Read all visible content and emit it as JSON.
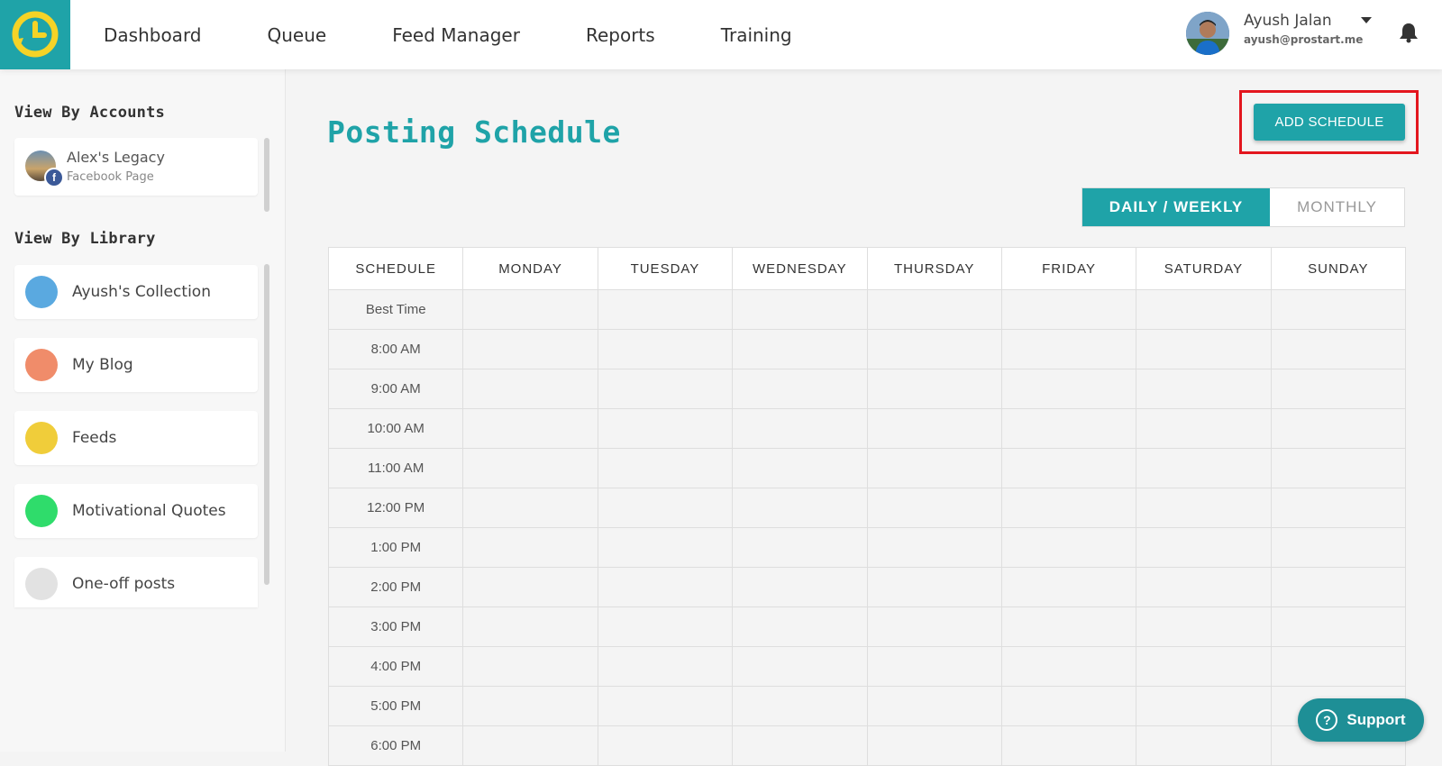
{
  "nav": {
    "items": [
      "Dashboard",
      "Queue",
      "Feed Manager",
      "Reports",
      "Training"
    ]
  },
  "user": {
    "name": "Ayush Jalan",
    "email": "ayush@prostart.me"
  },
  "sidebar": {
    "accounts_heading": "View By Accounts",
    "accounts": [
      {
        "name": "Alex's Legacy",
        "type": "Facebook Page",
        "badge": "f"
      }
    ],
    "library_heading": "View By Library",
    "library": [
      {
        "label": "Ayush's Collection",
        "color": "#5aa9e0"
      },
      {
        "label": "My Blog",
        "color": "#f08c6a"
      },
      {
        "label": "Feeds",
        "color": "#f0cd3a"
      },
      {
        "label": "Motivational Quotes",
        "color": "#2fdc6b"
      },
      {
        "label": "One-off posts",
        "color": "#e2e2e2"
      }
    ]
  },
  "main": {
    "title": "Posting Schedule",
    "add_button": "ADD SCHEDULE",
    "toggle": {
      "active": "DAILY / WEEKLY",
      "inactive": "MONTHLY"
    },
    "table": {
      "headers": [
        "SCHEDULE",
        "MONDAY",
        "TUESDAY",
        "WEDNESDAY",
        "THURSDAY",
        "FRIDAY",
        "SATURDAY",
        "SUNDAY"
      ],
      "rows": [
        "Best Time",
        "8:00 AM",
        "9:00 AM",
        "10:00 AM",
        "11:00 AM",
        "12:00 PM",
        "1:00 PM",
        "2:00 PM",
        "3:00 PM",
        "4:00 PM",
        "5:00 PM",
        "6:00 PM"
      ]
    }
  },
  "support": {
    "label": "Support"
  },
  "colors": {
    "accent": "#1fa3a8",
    "highlight": "#e3161e"
  }
}
